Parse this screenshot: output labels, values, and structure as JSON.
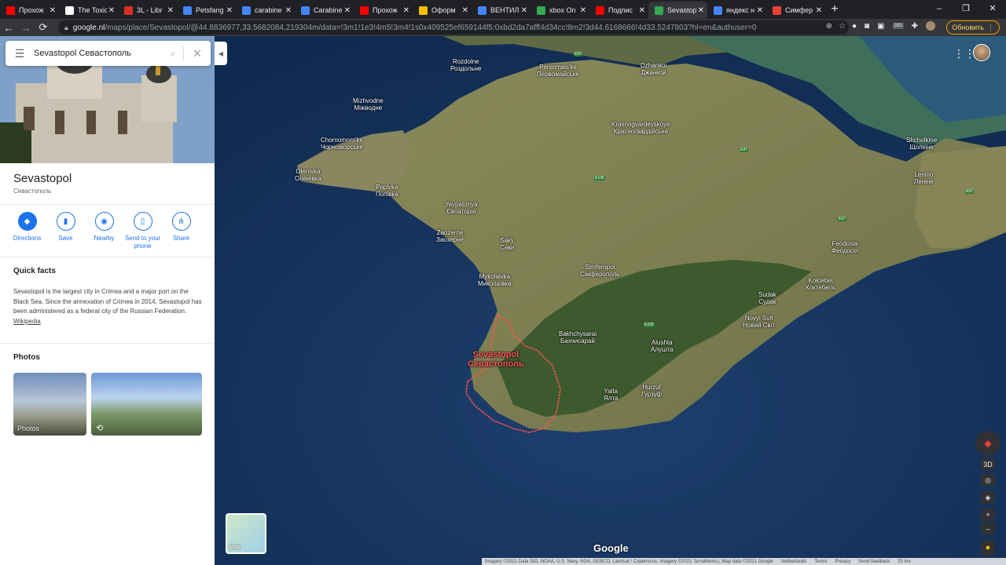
{
  "tabs": [
    {
      "title": "Прохож",
      "color": "#ff0000"
    },
    {
      "title": "The Toxic",
      "color": "#ffffff"
    },
    {
      "title": "3L - Libr",
      "color": "#d93025"
    },
    {
      "title": "Petsfang",
      "color": "#4285f4"
    },
    {
      "title": "carabine",
      "color": "#4285f4"
    },
    {
      "title": "Carabine",
      "color": "#4285f4"
    },
    {
      "title": "Прохож",
      "color": "#ff0000"
    },
    {
      "title": "Оформ",
      "color": "#fbbc04"
    },
    {
      "title": "ВЕНТИЛ",
      "color": "#4285f4"
    },
    {
      "title": "xbox On",
      "color": "#34a853"
    },
    {
      "title": "Подпис",
      "color": "#ff0000"
    },
    {
      "title": "Sevastop",
      "color": "#34a853"
    },
    {
      "title": "яндекс н",
      "color": "#4285f4"
    },
    {
      "title": "Симфер",
      "color": "#ea4335"
    }
  ],
  "window_controls": {
    "minimize": "–",
    "maximize": "❐",
    "close": "✕"
  },
  "toolbar": {
    "back": "←",
    "forward": "→",
    "reload": "⟳",
    "url_host": "google.nl",
    "url_path": "/maps/place/Sevastopol/@44.8836977,33.5682084,219304m/data=!3m1!1e3!4m5!3m4!1s0x409525ef659144f5:0xbd2da7afff4d34cc!8m2!3d44.6168666!4d33.5247803?hl=en&authuser=0",
    "update_label": "Обновить",
    "ext_badge": "283"
  },
  "search": {
    "query": "Sevastopol Севастополь"
  },
  "place": {
    "title": "Sevastopol",
    "subtitle": "Севастополь"
  },
  "actions": [
    {
      "label": "Directions",
      "icon": "◆"
    },
    {
      "label": "Save",
      "icon": "▮"
    },
    {
      "label": "Nearby",
      "icon": "◉"
    },
    {
      "label": "Send to your phone",
      "icon": "▯"
    },
    {
      "label": "Share",
      "icon": "⋔"
    }
  ],
  "quick_facts": {
    "title": "Quick facts",
    "text": "Sevastopol is the largest city in Crimea and a major port on the Black Sea. Since the annexation of Crimea in 2014, Sevastopol has been administered as a federal city of the Russian Federation.",
    "link": "Wikipedia"
  },
  "photos": {
    "title": "Photos",
    "items": [
      {
        "label": "Photos"
      },
      {
        "label": ""
      }
    ]
  },
  "map": {
    "places": [
      {
        "name": "Rozdolne\nРоздольне"
      },
      {
        "name": "Pervomais'ke\nПервомайське"
      },
      {
        "name": "Dzhankoi\nДжанкой"
      },
      {
        "name": "Mizhvodne\nМіжводне"
      },
      {
        "name": "Krasnogvardeyskoye\nКрасногвардійське"
      },
      {
        "name": "Chornomors'ke\nЧорноморське"
      },
      {
        "name": "Shcholkine\nЩолкіне"
      },
      {
        "name": "Olenivka\nОленівка"
      },
      {
        "name": "Popivka\nПопівка"
      },
      {
        "name": "Lenino\nЛеніне"
      },
      {
        "name": "Yevpatoriya\nЄвпаторія"
      },
      {
        "name": "Zaozerne\nЗаозерне"
      },
      {
        "name": "Saky\nСаки"
      },
      {
        "name": "Feodosia\nФеодосія"
      },
      {
        "name": "Simferopol\nСімферополь"
      },
      {
        "name": "Mykolaivka\nМиколаївка"
      },
      {
        "name": "Koktebel\nКоктебель"
      },
      {
        "name": "Sudak\nСудак"
      },
      {
        "name": "Novyi Svit\nНовий Світ"
      },
      {
        "name": "Bakhchysarai\nБахчисарай"
      },
      {
        "name": "Alushta\nАлушта"
      },
      {
        "name": "Hurzuf\nГурзуф"
      },
      {
        "name": "Yalta\nЯлта"
      }
    ],
    "highlight_place": "Sevastopol\nСевастополь",
    "roads": [
      "E97",
      "E97",
      "E105",
      "E97",
      "E97",
      "E105"
    ],
    "logo": "Google",
    "layer_toggle": "Map",
    "attribution": [
      "Imagery ©2021 Data SIO, NOAA, U.S. Navy, NGA, GEBCO, Landsat / Copernicus, Imagery ©2021 TerraMetrics, Map data ©2021 Google",
      "Netherlands",
      "Terms",
      "Privacy",
      "Send feedback",
      "20 km"
    ],
    "controls": {
      "threed": "3D",
      "zoom_in": "+",
      "zoom_out": "–"
    }
  }
}
